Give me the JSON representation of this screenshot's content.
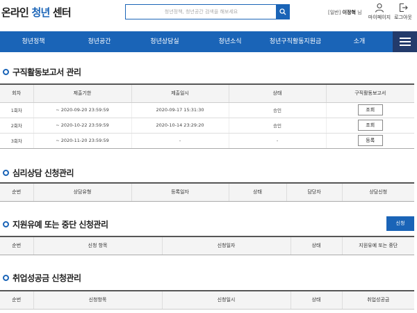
{
  "header": {
    "logo_prefix": "온라인 ",
    "logo_accent": "청년",
    "logo_suffix": " 센터",
    "search_placeholder": "청년정책, 청년공간 검색을 해보세요",
    "user_type": "[일반]",
    "user_name": "이정혁",
    "user_suffix": "님",
    "mypage_label": "마이페이지",
    "logout_label": "로그아웃"
  },
  "nav": [
    "청년정책",
    "청년공간",
    "청년상담실",
    "청년소식",
    "청년구직활동지원금",
    "소개"
  ],
  "section1": {
    "title": "구직활동보고서 관리",
    "headers": [
      "회차",
      "제출기한",
      "제출일시",
      "상태",
      "구직활동보고서"
    ],
    "rows": [
      {
        "round": "1회차",
        "deadline": "~ 2020-09-20 23:59:59",
        "submitted": "2020-09-17 15:31:30",
        "status": "승인",
        "action": "조회"
      },
      {
        "round": "2회차",
        "deadline": "~ 2020-10-22 23:59:59",
        "submitted": "2020-10-14 23:29:20",
        "status": "승인",
        "action": "조회"
      },
      {
        "round": "3회차",
        "deadline": "~ 2020-11-20 23:59:59",
        "submitted": "-",
        "status": "-",
        "action": "등록"
      }
    ]
  },
  "section2": {
    "title": "심리상담 신청관리",
    "headers": [
      "순번",
      "상담유형",
      "등록일자",
      "상태",
      "담당자",
      "상담신청"
    ]
  },
  "section3": {
    "title": "지원유예 또는 중단 신청관리",
    "apply_label": "신청",
    "headers": [
      "순번",
      "신청 항목",
      "신청일자",
      "상태",
      "지원유예 또는 중단"
    ]
  },
  "section4": {
    "title": "취업성공금 신청관리",
    "headers": [
      "순번",
      "신청항목",
      "신청일시",
      "상태",
      "취업성공금"
    ]
  },
  "colors": {
    "primary": "#1a64b7",
    "menu_dark": "#233b6b"
  },
  "icons": {
    "search": "search-icon",
    "mypage": "user-icon",
    "logout": "logout-icon",
    "menu": "hamburger-icon"
  }
}
